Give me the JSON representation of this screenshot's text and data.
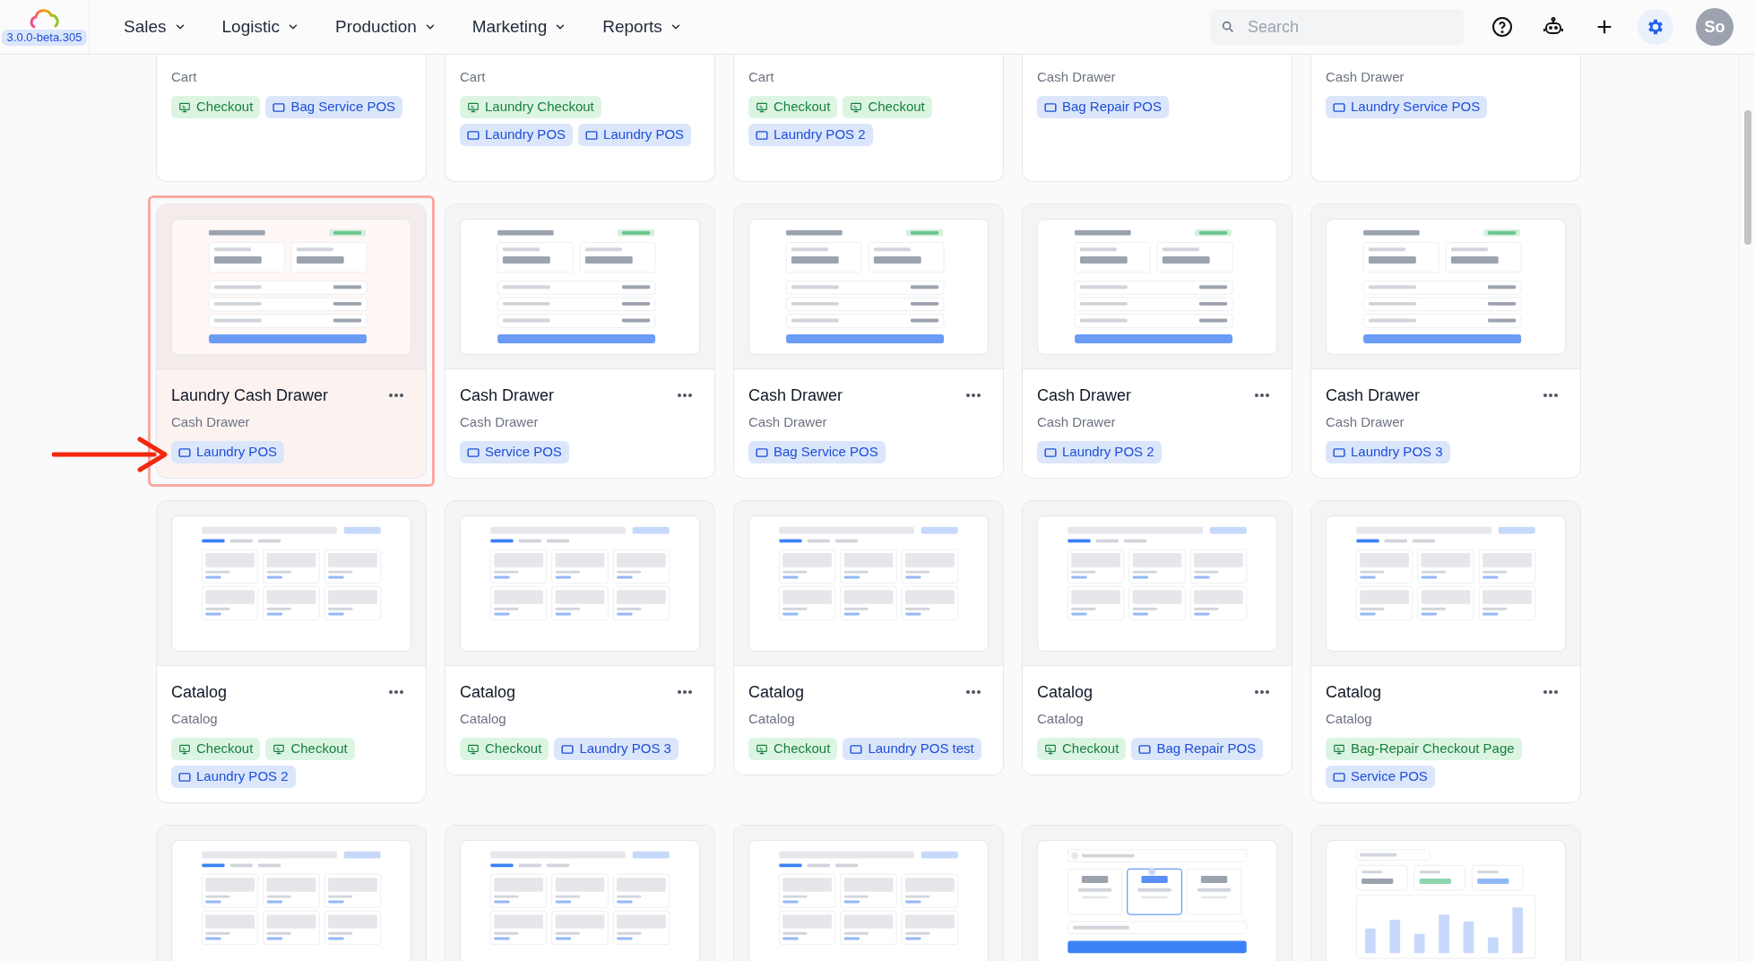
{
  "app": {
    "version": "3.0.0-beta.305"
  },
  "nav": {
    "menus": [
      {
        "label": "Sales"
      },
      {
        "label": "Logistic"
      },
      {
        "label": "Production"
      },
      {
        "label": "Marketing"
      },
      {
        "label": "Reports"
      }
    ],
    "search": {
      "placeholder": "Search"
    },
    "avatar": "So"
  },
  "rows": [
    {
      "cards": [
        {
          "subtitle": "Cart",
          "selected": false,
          "tags": [
            {
              "kind": "checkout",
              "label": "Checkout"
            },
            {
              "kind": "pos",
              "label": "Bag Service POS"
            }
          ]
        },
        {
          "subtitle": "Cart",
          "selected": false,
          "tags": [
            {
              "kind": "checkout",
              "label": "Laundry Checkout"
            },
            {
              "kind": "pos",
              "label": "Laundry POS"
            },
            {
              "kind": "pos",
              "label": "Laundry POS"
            }
          ]
        },
        {
          "subtitle": "Cart",
          "selected": false,
          "tags": [
            {
              "kind": "checkout",
              "label": "Checkout"
            },
            {
              "kind": "checkout",
              "label": "Checkout"
            },
            {
              "kind": "pos",
              "label": "Laundry POS 2"
            }
          ]
        },
        {
          "subtitle": "Cash Drawer",
          "selected": false,
          "tags": [
            {
              "kind": "pos",
              "label": "Bag Repair POS"
            }
          ]
        },
        {
          "subtitle": "Cash Drawer",
          "selected": false,
          "tags": [
            {
              "kind": "pos",
              "label": "Laundry Service POS"
            }
          ]
        }
      ]
    },
    {
      "cards": [
        {
          "preview": {
            "kind": "form"
          },
          "title": "Laundry Cash Drawer",
          "subtitle": "Cash Drawer",
          "selected": true,
          "tags": [
            {
              "kind": "pos",
              "label": "Laundry POS"
            }
          ]
        },
        {
          "preview": {
            "kind": "form"
          },
          "title": "Cash Drawer",
          "subtitle": "Cash Drawer",
          "selected": false,
          "tags": [
            {
              "kind": "pos",
              "label": "Service POS"
            }
          ]
        },
        {
          "preview": {
            "kind": "form"
          },
          "title": "Cash Drawer",
          "subtitle": "Cash Drawer",
          "selected": false,
          "tags": [
            {
              "kind": "pos",
              "label": "Bag Service POS"
            }
          ]
        },
        {
          "preview": {
            "kind": "form"
          },
          "title": "Cash Drawer",
          "subtitle": "Cash Drawer",
          "selected": false,
          "tags": [
            {
              "kind": "pos",
              "label": "Laundry POS 2"
            }
          ]
        },
        {
          "preview": {
            "kind": "form"
          },
          "title": "Cash Drawer",
          "subtitle": "Cash Drawer",
          "selected": false,
          "tags": [
            {
              "kind": "pos",
              "label": "Laundry POS 3"
            }
          ]
        }
      ]
    },
    {
      "cards": [
        {
          "preview": {
            "kind": "grid"
          },
          "title": "Catalog",
          "subtitle": "Catalog",
          "selected": false,
          "tags": [
            {
              "kind": "checkout",
              "label": "Checkout"
            },
            {
              "kind": "checkout",
              "label": "Checkout"
            },
            {
              "kind": "pos",
              "label": "Laundry POS 2"
            }
          ]
        },
        {
          "preview": {
            "kind": "grid"
          },
          "title": "Catalog",
          "subtitle": "Catalog",
          "selected": false,
          "tags": [
            {
              "kind": "checkout",
              "label": "Checkout"
            },
            {
              "kind": "pos",
              "label": "Laundry POS 3"
            }
          ]
        },
        {
          "preview": {
            "kind": "grid"
          },
          "title": "Catalog",
          "subtitle": "Catalog",
          "selected": false,
          "tags": [
            {
              "kind": "checkout",
              "label": "Checkout"
            },
            {
              "kind": "pos",
              "label": "Laundry POS test"
            }
          ]
        },
        {
          "preview": {
            "kind": "grid"
          },
          "title": "Catalog",
          "subtitle": "Catalog",
          "selected": false,
          "tags": [
            {
              "kind": "checkout",
              "label": "Checkout"
            },
            {
              "kind": "pos",
              "label": "Bag Repair POS"
            }
          ]
        },
        {
          "preview": {
            "kind": "grid"
          },
          "title": "Catalog",
          "subtitle": "Catalog",
          "selected": false,
          "tags": [
            {
              "kind": "checkout",
              "label": "Bag-Repair Checkout Page"
            },
            {
              "kind": "pos",
              "label": "Service POS"
            }
          ]
        }
      ]
    },
    {
      "cards": [
        {
          "preview": {
            "kind": "grid"
          },
          "selected": false
        },
        {
          "preview": {
            "kind": "grid"
          },
          "selected": false
        },
        {
          "preview": {
            "kind": "grid"
          },
          "selected": false
        },
        {
          "preview": {
            "kind": "selector"
          },
          "selected": false
        },
        {
          "preview": {
            "kind": "chart"
          },
          "selected": false
        }
      ]
    }
  ]
}
